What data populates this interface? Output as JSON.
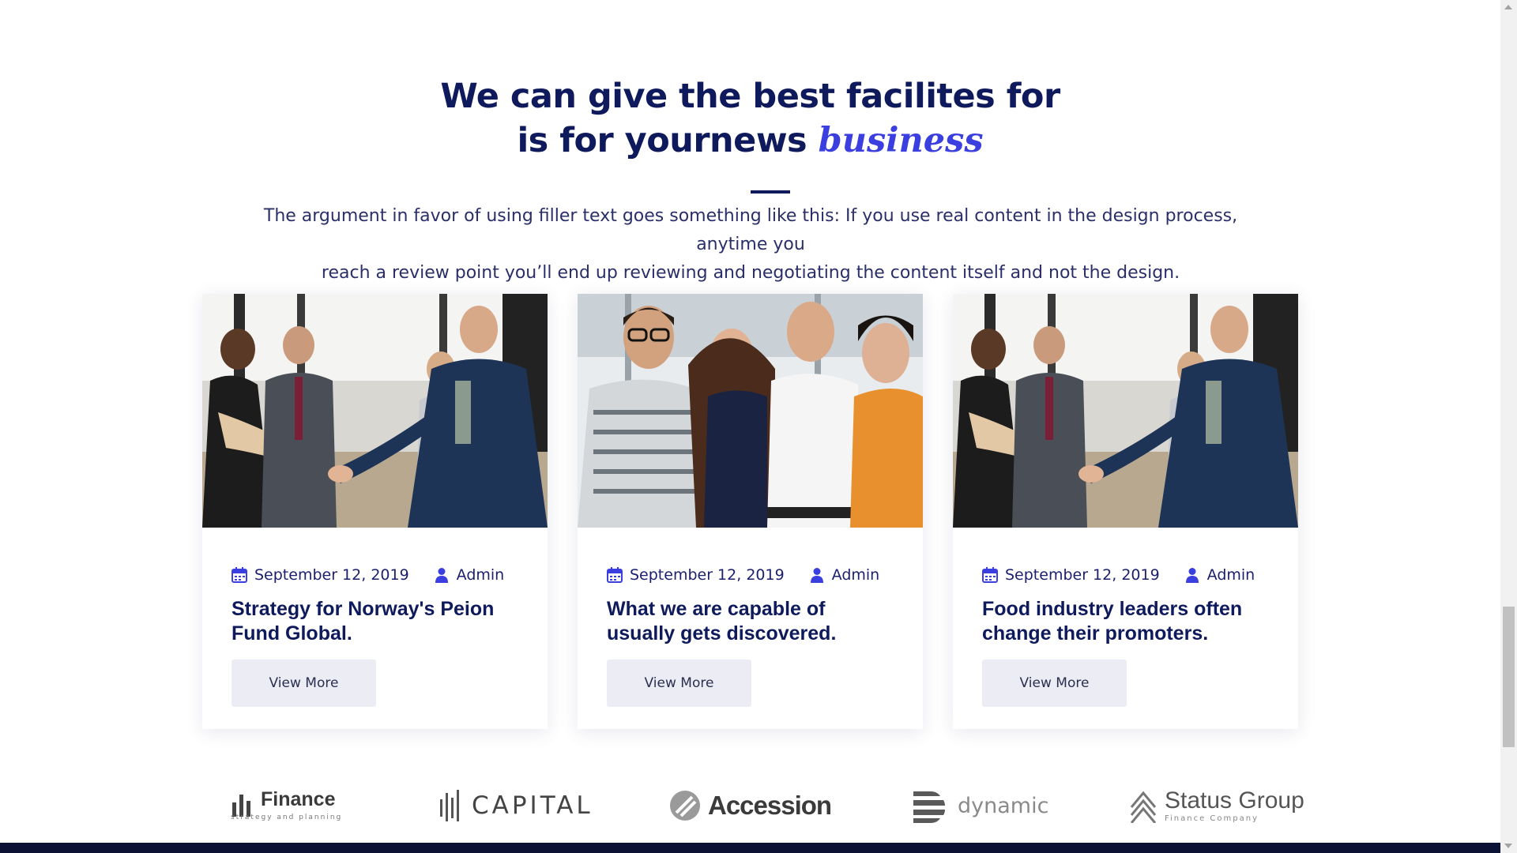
{
  "section": {
    "heading_line1": "We can give the best facilites for",
    "heading_line2": "is for yournews",
    "heading_accent": "business",
    "lead_line1": "The argument in favor of using filler text goes something like this: If you use real content in the design process, anytime you",
    "lead_line2": "reach a review point you’ll end up reviewing and negotiating the content itself and not the design."
  },
  "posts": [
    {
      "date": "September 12, 2019",
      "author": "Admin",
      "title_line1": "Strategy for Norway's Peion",
      "title_line2": "Fund Global.",
      "button": "View More",
      "photo": "handshake-meeting"
    },
    {
      "date": "September 12, 2019",
      "author": "Admin",
      "title_line1": "What we are capable of",
      "title_line2": "usually gets discovered.",
      "button": "View More",
      "photo": "smiling-team"
    },
    {
      "date": "September 12, 2019",
      "author": "Admin",
      "title_line1": "Food industry leaders often",
      "title_line2": "change their promoters.",
      "button": "View More",
      "photo": "handshake-meeting"
    }
  ],
  "logos": [
    {
      "name": "Finance",
      "tagline": "strategy and planning"
    },
    {
      "name": "CAPITAL",
      "tagline": ""
    },
    {
      "name": "Accession",
      "tagline": ""
    },
    {
      "name": "dynamic",
      "tagline": ""
    },
    {
      "name": "Status Group",
      "tagline": "Finance Company"
    }
  ],
  "colors": {
    "navy": "#0e1a5c",
    "accent": "#3b3fe0",
    "button_bg": "#ececf4",
    "footer": "#0c1233"
  },
  "icons": {
    "date": "calendar-icon",
    "author": "user-icon"
  }
}
